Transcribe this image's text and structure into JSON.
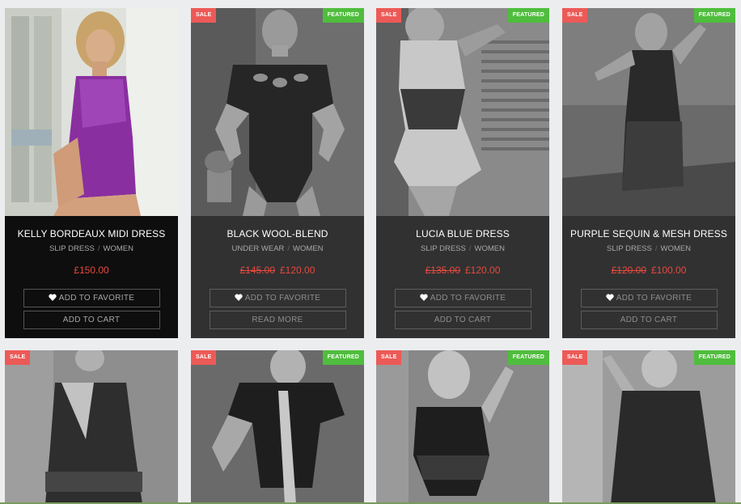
{
  "products": [
    {
      "title": "KELLY BORDEAUX MIDI DRESS",
      "category": "SLIP DRESS",
      "subcategory": "WOMEN",
      "price": "£150.00",
      "old_price": null,
      "favorite_label": "ADD TO FAVORITE",
      "action_label": "ADD TO CART",
      "badges": []
    },
    {
      "title": "BLACK WOOL-BLEND",
      "category": "UNDER WEAR",
      "subcategory": "WOMEN",
      "price": "£120.00",
      "old_price": "£145.00",
      "favorite_label": "ADD TO FAVORITE",
      "action_label": "READ MORE",
      "badges": [
        "SALE",
        "FEATURED"
      ]
    },
    {
      "title": "LUCIA BLUE DRESS",
      "category": "SLIP DRESS",
      "subcategory": "WOMEN",
      "price": "£120.00",
      "old_price": "£135.00",
      "favorite_label": "ADD TO FAVORITE",
      "action_label": "ADD TO CART",
      "badges": [
        "SALE",
        "FEATURED"
      ]
    },
    {
      "title": "PURPLE SEQUIN & MESH DRESS",
      "category": "SLIP DRESS",
      "subcategory": "WOMEN",
      "price": "£100.00",
      "old_price": "£120.00",
      "favorite_label": "ADD TO FAVORITE",
      "action_label": "ADD TO CART",
      "badges": [
        "SALE",
        "FEATURED"
      ]
    }
  ],
  "row2_badges": [
    [
      "SALE"
    ],
    [
      "SALE",
      "FEATURED"
    ],
    [
      "SALE",
      "FEATURED"
    ],
    [
      "SALE",
      "FEATURED"
    ]
  ],
  "colors": {
    "sale_badge": "#ec5a57",
    "featured_badge": "#4fbd3d",
    "price_red": "#e8493f",
    "card_dark": "#313131",
    "card_active": "#0e0e0e",
    "dress_purple": "#8a2fa0"
  },
  "icons": {
    "favorite": "heart-icon"
  }
}
